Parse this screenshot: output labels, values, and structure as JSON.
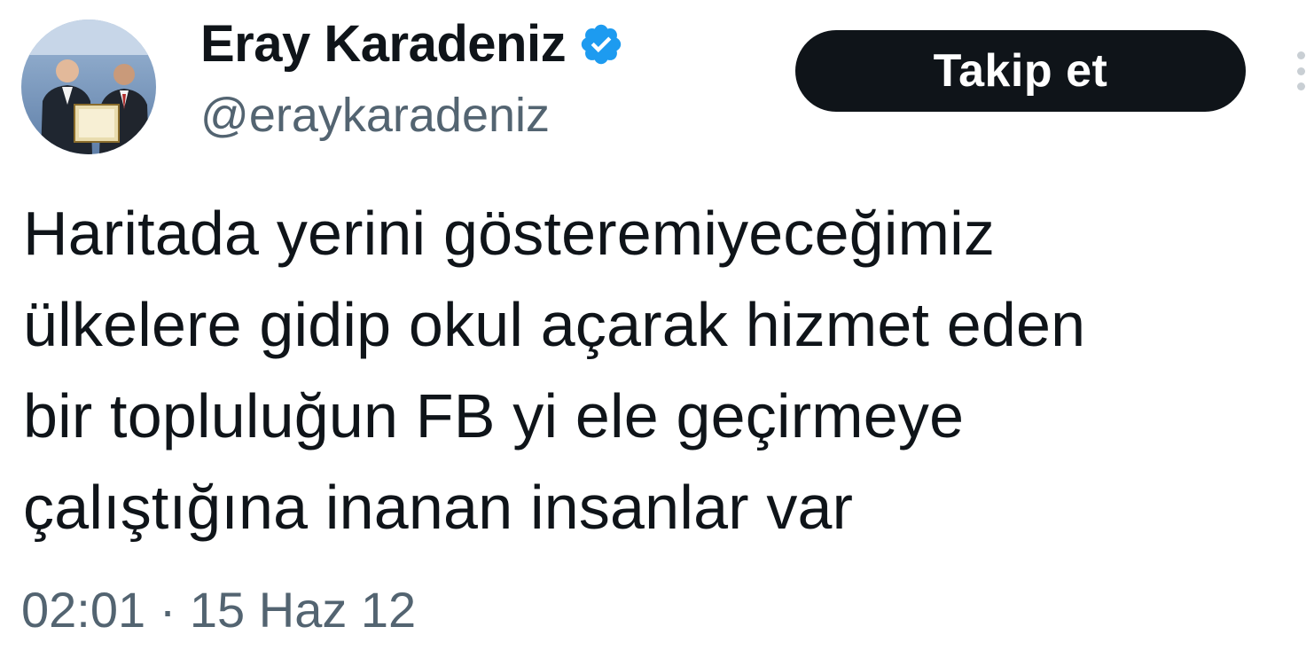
{
  "tweet": {
    "author": {
      "display_name": "Eray Karadeniz",
      "handle": "@eraykaradeniz",
      "verified": true,
      "avatar_icon": "profile-photo"
    },
    "follow_button_label": "Takip et",
    "more_icon": "more-dots-icon",
    "text": "Haritada yerini gösteremiyeceğimiz\nülkelere gidip okul açarak hizmet eden\nbir topluluğun FB yi ele geçirmeye\nçalıştığına inanan insanlar var",
    "timestamp": "02:01 · 15 Haz 12"
  },
  "colors": {
    "text_primary": "#0f1419",
    "text_secondary": "#536471",
    "verified_badge": "#1d9bf0",
    "button_bg": "#0f1419",
    "button_text": "#ffffff"
  }
}
